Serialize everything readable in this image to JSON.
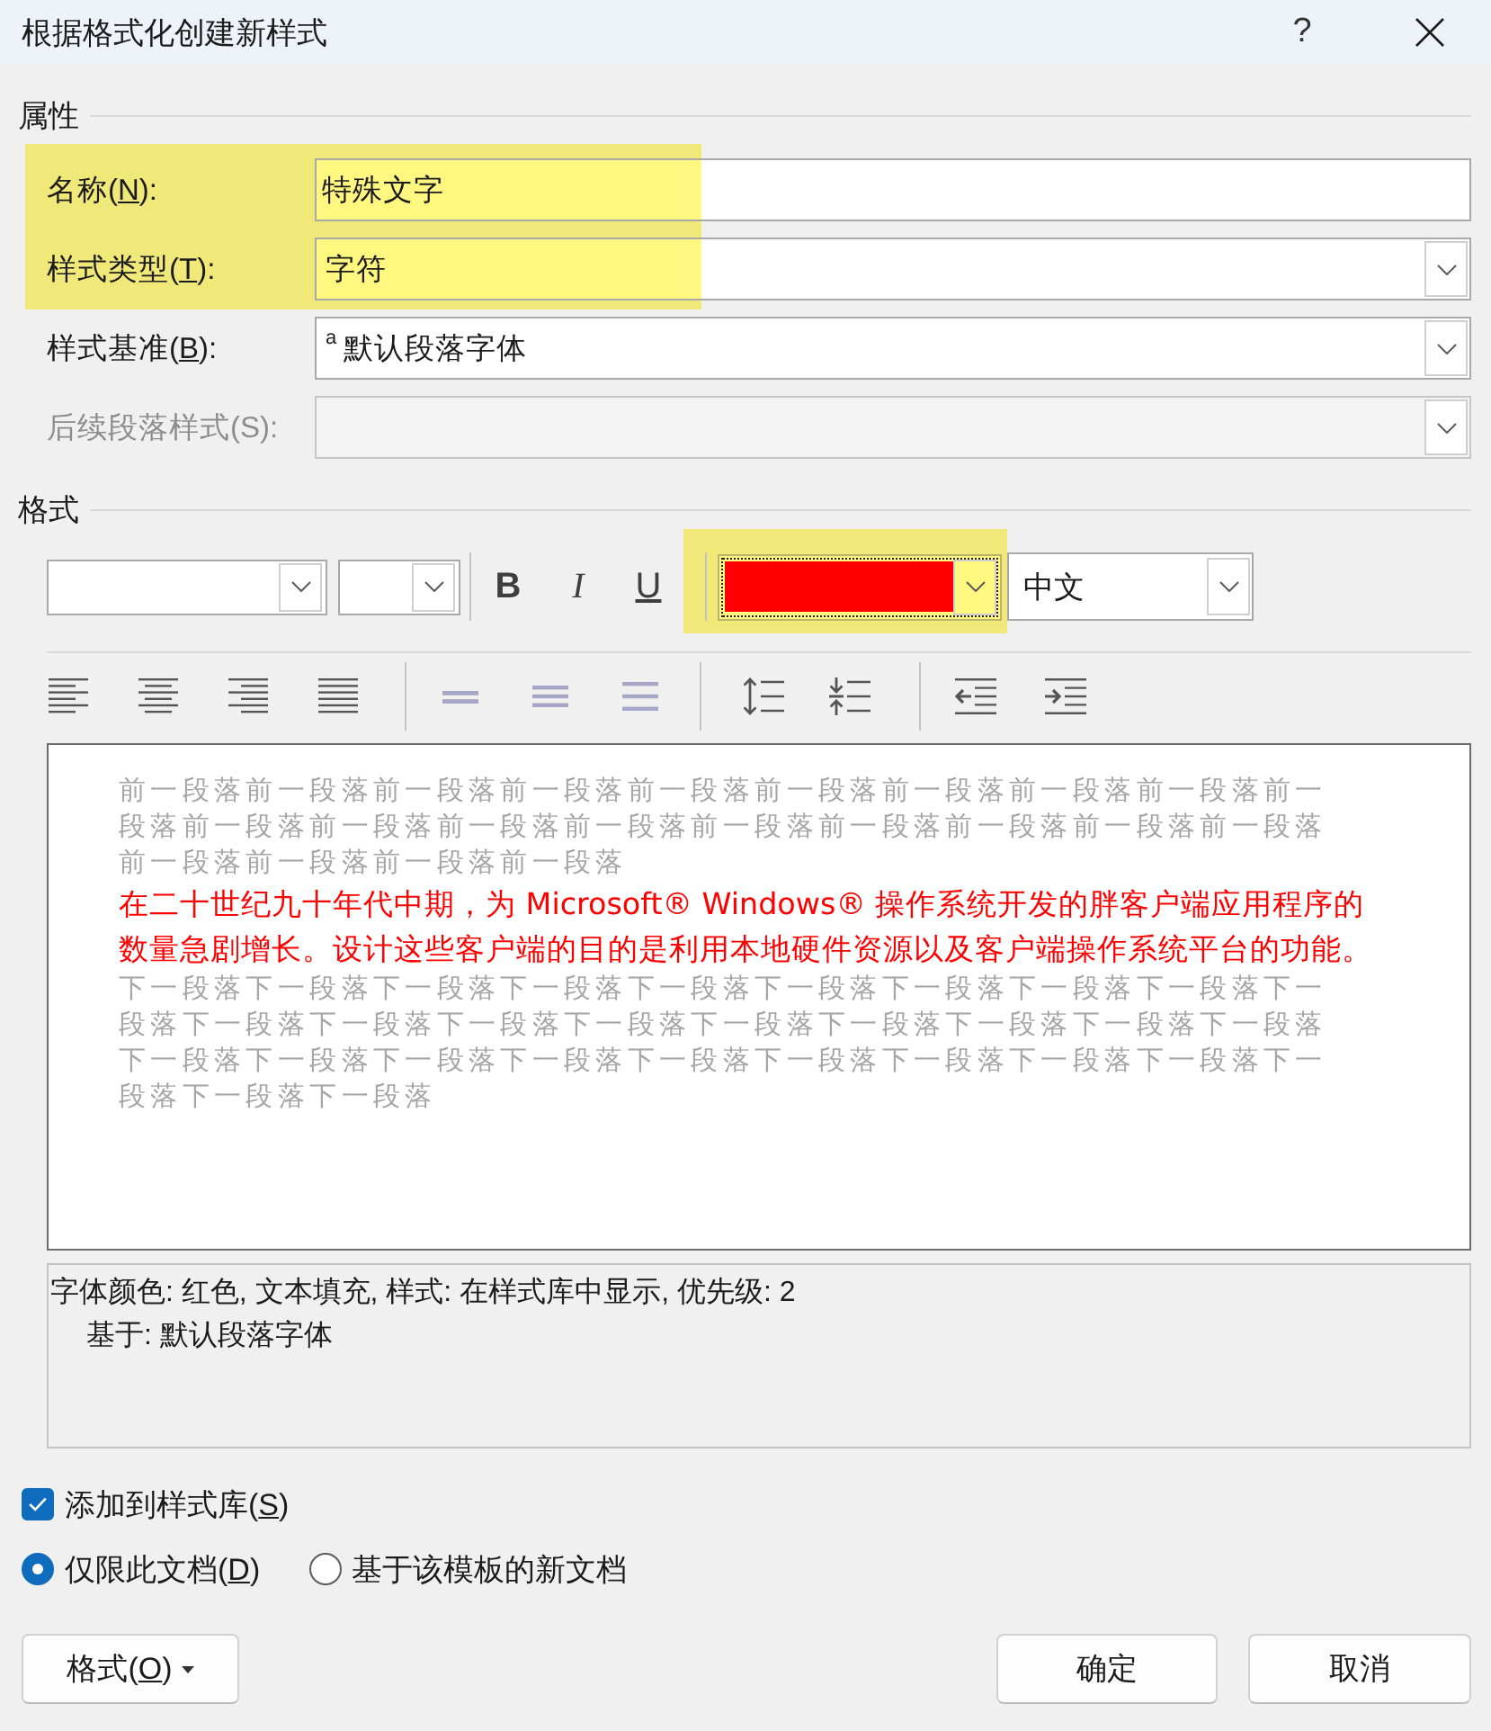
{
  "window": {
    "title": "根据格式化创建新样式",
    "help": "?"
  },
  "properties": {
    "heading": "属性",
    "rows": [
      {
        "kind": "text",
        "label": "名称(",
        "access_key": "N",
        "label_end": "):",
        "value": "特殊文字",
        "highlighted": true,
        "disabled": false
      },
      {
        "kind": "dropdown",
        "label": "样式类型(",
        "access_key": "T",
        "label_end": "):",
        "value": "字符",
        "highlighted": true,
        "disabled": false
      },
      {
        "kind": "dropdown",
        "label": "样式基准(",
        "access_key": "B",
        "label_end": "):",
        "glyph": "a",
        "value": "默认段落字体",
        "highlighted": false,
        "disabled": false
      },
      {
        "kind": "dropdown",
        "label": "后续段落样式(S):",
        "highlighted": false,
        "disabled": true
      }
    ]
  },
  "format": {
    "heading": "格式",
    "style_buttons": [
      {
        "kind": "bold",
        "label": "B"
      },
      {
        "kind": "italic",
        "label": "I"
      },
      {
        "kind": "underline",
        "label": "U"
      }
    ],
    "font_color": {
      "color": "#ff0000",
      "highlighted": true,
      "focused": true
    },
    "language": "中文"
  },
  "preview": {
    "paragraphs": [
      {
        "kind": "previous",
        "text": "前一段落前一段落前一段落前一段落前一段落前一段落前一段落前一段落前一段落前一段落前一段落前一段落前一段落前一段落前一段落前一段落前一段落前一段落前一段落前一段落前一段落前一段落前一段落"
      },
      {
        "kind": "sample",
        "text": "在二十世纪九十年代中期，为 Microsoft® Windows® 操作系统开发的胖客户端应用程序的数量急剧增长。设计这些客户端的目的是利用本地硬件资源以及客户端操作系统平台的功能。"
      },
      {
        "kind": "next",
        "text": "下一段落下一段落下一段落下一段落下一段落下一段落下一段落下一段落下一段落下一段落下一段落下一段落下一段落下一段落下一段落下一段落下一段落下一段落下一段落下一段落下一段落下一段落下一段落下一段落下一段落下一段落下一段落下一段落下一段落下一段落下一段落"
      }
    ]
  },
  "description": {
    "summary": "字体颜色: 红色, 文本填充, 样式: 在样式库中显示, 优先级: 2",
    "based_on": "基于: 默认段落字体"
  },
  "add_to_gallery": {
    "label": "添加到样式库(",
    "access_key": "S",
    "label_end": ")",
    "checked": true
  },
  "scope": [
    {
      "label": "仅限此文档(",
      "access_key": "D",
      "label_end": ")",
      "selected": true
    },
    {
      "label": "基于该模板的新文档",
      "selected": false
    }
  ],
  "buttons": {
    "format": {
      "label": "格式(",
      "access_key": "O",
      "label_end": ")"
    },
    "ok": "确定",
    "cancel": "取消"
  }
}
